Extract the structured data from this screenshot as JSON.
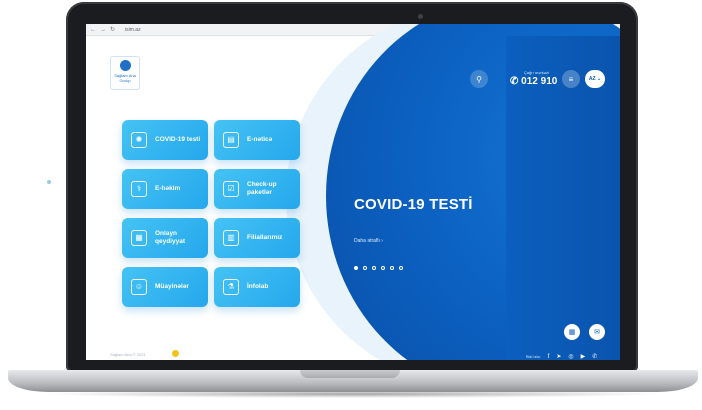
{
  "browser": {
    "url": "isim.az",
    "nav": [
      "←",
      "→",
      "↻"
    ]
  },
  "brand": {
    "logo_text": "Sağlam Ana\nGroup",
    "accent": "#0b5fbf",
    "tile_color": "#2fb1ef"
  },
  "tiles": [
    {
      "label": "COVID-19 testi",
      "icon": "virus-icon",
      "glyph": "✺"
    },
    {
      "label": "E-nəticə",
      "icon": "document-icon",
      "glyph": "▤"
    },
    {
      "label": "E-həkim",
      "icon": "doctor-icon",
      "glyph": "⚕"
    },
    {
      "label": "Check-up paketlər",
      "icon": "checklist-icon",
      "glyph": "☑"
    },
    {
      "label": "Onlayn qeydiyyat",
      "icon": "calendar-icon",
      "glyph": "▦"
    },
    {
      "label": "Filiallarımız",
      "icon": "building-icon",
      "glyph": "▥"
    },
    {
      "label": "Müayinələr",
      "icon": "people-icon",
      "glyph": "☺"
    },
    {
      "label": "İnfolab",
      "icon": "lab-icon",
      "glyph": "⚗"
    }
  ],
  "header": {
    "call_label": "Çağrı mərkəzi",
    "phone": "012 910",
    "language": "AZ"
  },
  "hero": {
    "title": "COVID-19 TESTİ",
    "link": "Daha ətraflı",
    "slides": 6,
    "active_slide": 0
  },
  "footer": {
    "copyright": "Sağlam Ana © 2021",
    "social_label": "Bizi izlə:",
    "social_icons": [
      "facebook-icon",
      "telegram-icon",
      "instagram-icon",
      "youtube-icon",
      "whatsapp-icon"
    ]
  }
}
